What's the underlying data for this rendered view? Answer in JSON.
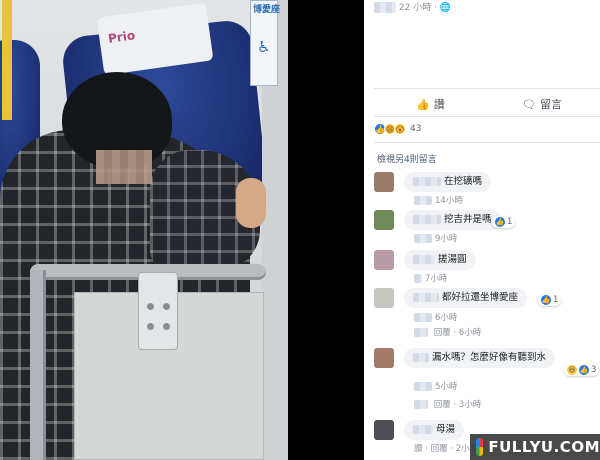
{
  "photo": {
    "priority_seat_text": "Prio",
    "sign_text": "博愛座"
  },
  "post": {
    "timestamp": "22 小時",
    "actions": {
      "like_label": "讚",
      "comment_label": "留言"
    },
    "reactions": {
      "count": "43",
      "types": [
        "like-icon",
        "haha-icon",
        "wow-icon"
      ]
    },
    "view_more_comments": "檢視另4則留言",
    "comments": [
      {
        "text": "在挖礦嗎",
        "time": "14小時",
        "avatar_color": "#9a7b67"
      },
      {
        "text": "挖吉井是嗎",
        "time": "9小時",
        "reaction_count": "1",
        "avatar_color": "#6f8a5a"
      },
      {
        "text": "搓湯圓",
        "time": "7小時",
        "avatar_color": "#b79aa5"
      },
      {
        "text": "都好拉還坐博愛座",
        "time": "6小時",
        "reply_label": "回覆",
        "reply_time": "6小時",
        "reaction_count": "1",
        "avatar_color": "#c9c6c2"
      },
      {
        "text": "漏水嗎？怎麼好像有聽到水",
        "time": "5小時",
        "reply_label": "回覆",
        "reply_time": "3小時",
        "reaction_count": "3",
        "avatar_color": "#a27c69"
      },
      {
        "text": "母湯",
        "like_label": "讚",
        "reply_label": "回覆",
        "time": "2小時",
        "avatar_color": "#4d4f55"
      }
    ]
  },
  "watermark": {
    "text": "FULLYU.COM"
  },
  "colors": {
    "facebook_blue": "#1877f2",
    "bubble_bg": "#f0f2f5",
    "seat_blue": "#1c2f72"
  }
}
